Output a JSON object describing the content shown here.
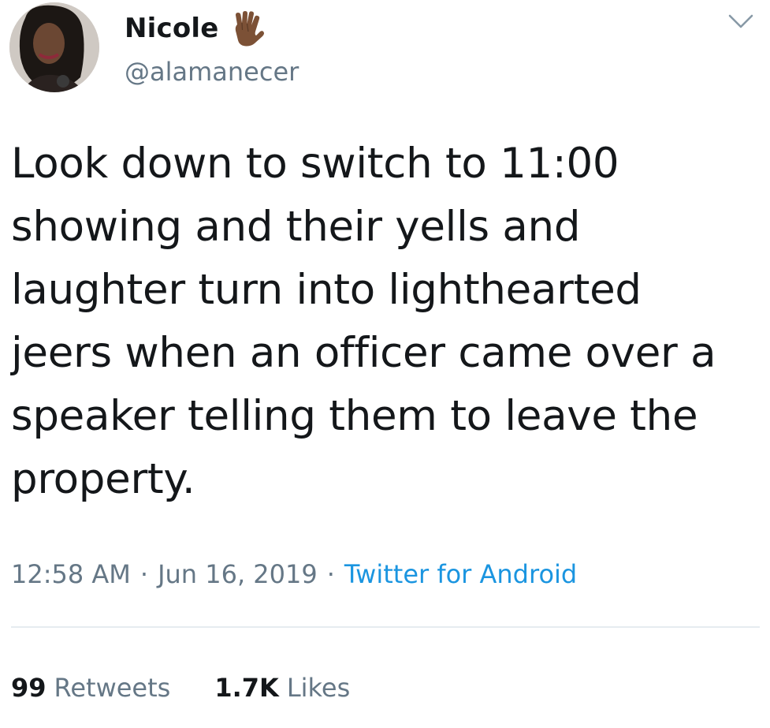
{
  "user": {
    "display_name": "Nicole",
    "handle": "@alamanecer",
    "name_emoji": "vulcan-salute-medium-dark-skin-tone"
  },
  "tweet": {
    "text": "Look down to switch to 11:00\nshowing and their yells and\nlaughter turn into lighthearted\njeers when an officer came over a\nspeaker telling them to leave the\nproperty."
  },
  "meta": {
    "time": "12:58 AM",
    "separator": "·",
    "date": "Jun 16, 2019",
    "source": "Twitter for Android"
  },
  "stats": {
    "retweets_count": "99",
    "retweets_label": "Retweets",
    "likes_count": "1.7K",
    "likes_label": "Likes"
  },
  "colors": {
    "text_primary": "#14171a",
    "text_secondary": "#657786",
    "link": "#1b95e0",
    "divider": "#e6ecf0"
  }
}
